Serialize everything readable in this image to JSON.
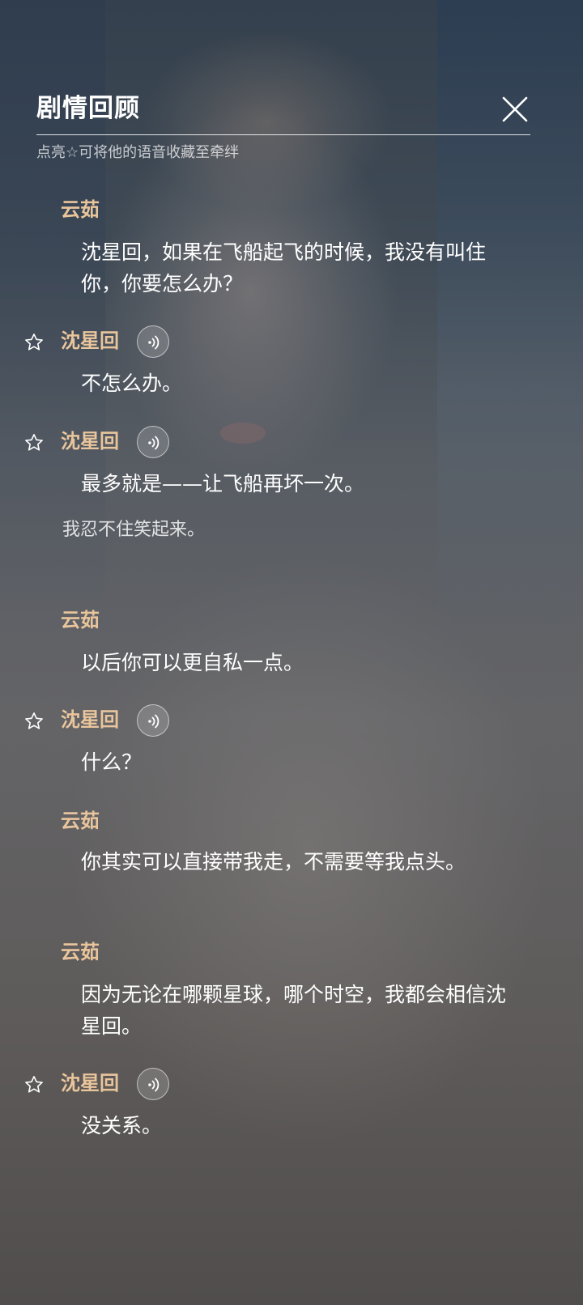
{
  "header": {
    "title": "剧情回顾",
    "hint": "点亮☆可将他的语音收藏至牵绊"
  },
  "colors": {
    "speaker": "#e9c59c",
    "text": "#ffffff",
    "hint": "#c9c9c9"
  },
  "icons": {
    "close": "close-icon",
    "star": "star-outline-icon",
    "voice": "voice-play-icon"
  },
  "dialogue": [
    {
      "speaker": "云茹",
      "text": "沈星回，如果在飞船起飞的时候，我没有叫住你，你要怎么办？"
    },
    {
      "speaker": "沈星回",
      "text": "不怎么办。"
    },
    {
      "speaker": "沈星回",
      "text": "最多就是——让飞船再坏一次。"
    },
    {
      "narration": "我忍不住笑起来。"
    },
    {
      "speaker": "云茹",
      "text": "以后你可以更自私一点。"
    },
    {
      "speaker": "沈星回",
      "text": "什么？"
    },
    {
      "speaker": "云茹",
      "text": "你其实可以直接带我走，不需要等我点头。"
    },
    {
      "speaker": "云茹",
      "text": "因为无论在哪颗星球，哪个时空，我都会相信沈星回。"
    },
    {
      "speaker": "沈星回",
      "text": "没关系。"
    }
  ]
}
